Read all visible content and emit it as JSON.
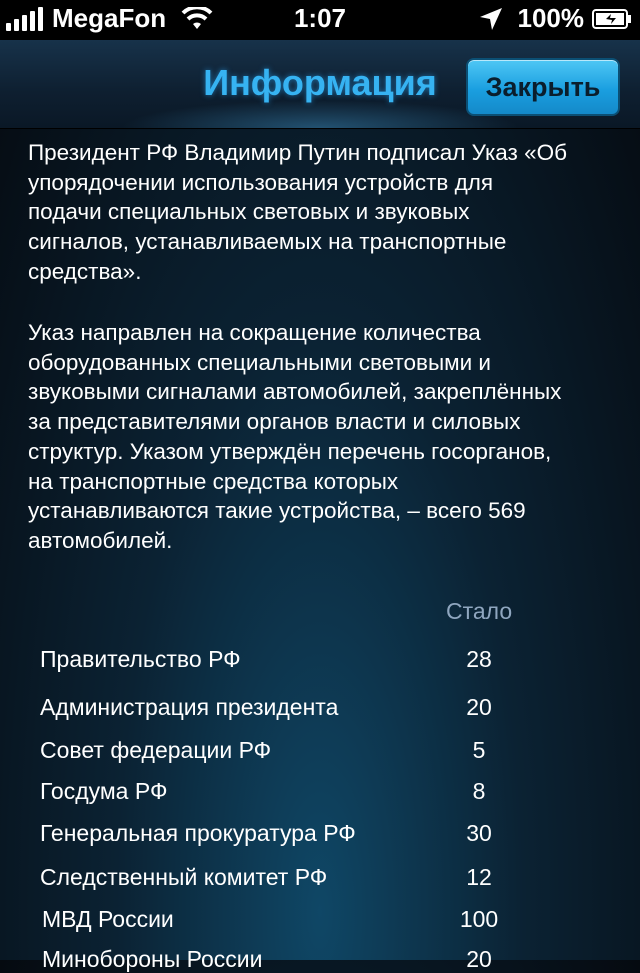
{
  "status_bar": {
    "carrier": "MegaFon",
    "time": "1:07",
    "battery": "100%",
    "icons": [
      "signal-icon",
      "wifi-icon",
      "location-icon",
      "battery-icon"
    ]
  },
  "nav": {
    "title": "Информация",
    "close_label": "Закрыть"
  },
  "body": {
    "paragraph1": "Президент РФ Владимир Путин подписал Указ «Об\nупорядочении использования устройств для\nподачи специальных световых и звуковых\nсигналов, устанавливаемых на транспортные\nсредства».",
    "paragraph2": "Указ направлен на сокращение количества\nоборудованных специальными световыми и\nзвуковыми сигналами автомобилей, закреплённых\nза представителями органов власти и силовых\nструктур. Указом утверждён перечень госорганов,\nна транспортные средства которых\nустанавливаются такие устройства, – всего 569\nавтомобилей."
  },
  "table": {
    "column_header": "Стало",
    "rows": [
      {
        "name": "Правительство РФ",
        "value": "28"
      },
      {
        "name": "Администрация президента",
        "value": "20"
      },
      {
        "name": "Совет федерации РФ",
        "value": "5"
      },
      {
        "name": "Госдума РФ",
        "value": "8"
      },
      {
        "name": "Генеральная прокуратура РФ",
        "value": "30"
      },
      {
        "name": "Следственный комитет РФ",
        "value": "12"
      },
      {
        "name": "МВД России",
        "value": "100"
      },
      {
        "name": "Минобороны России",
        "value": "20"
      }
    ]
  },
  "colors": {
    "title": "#36b3f2",
    "button": "#1a9fe0",
    "header_text": "#8fa6bf"
  }
}
